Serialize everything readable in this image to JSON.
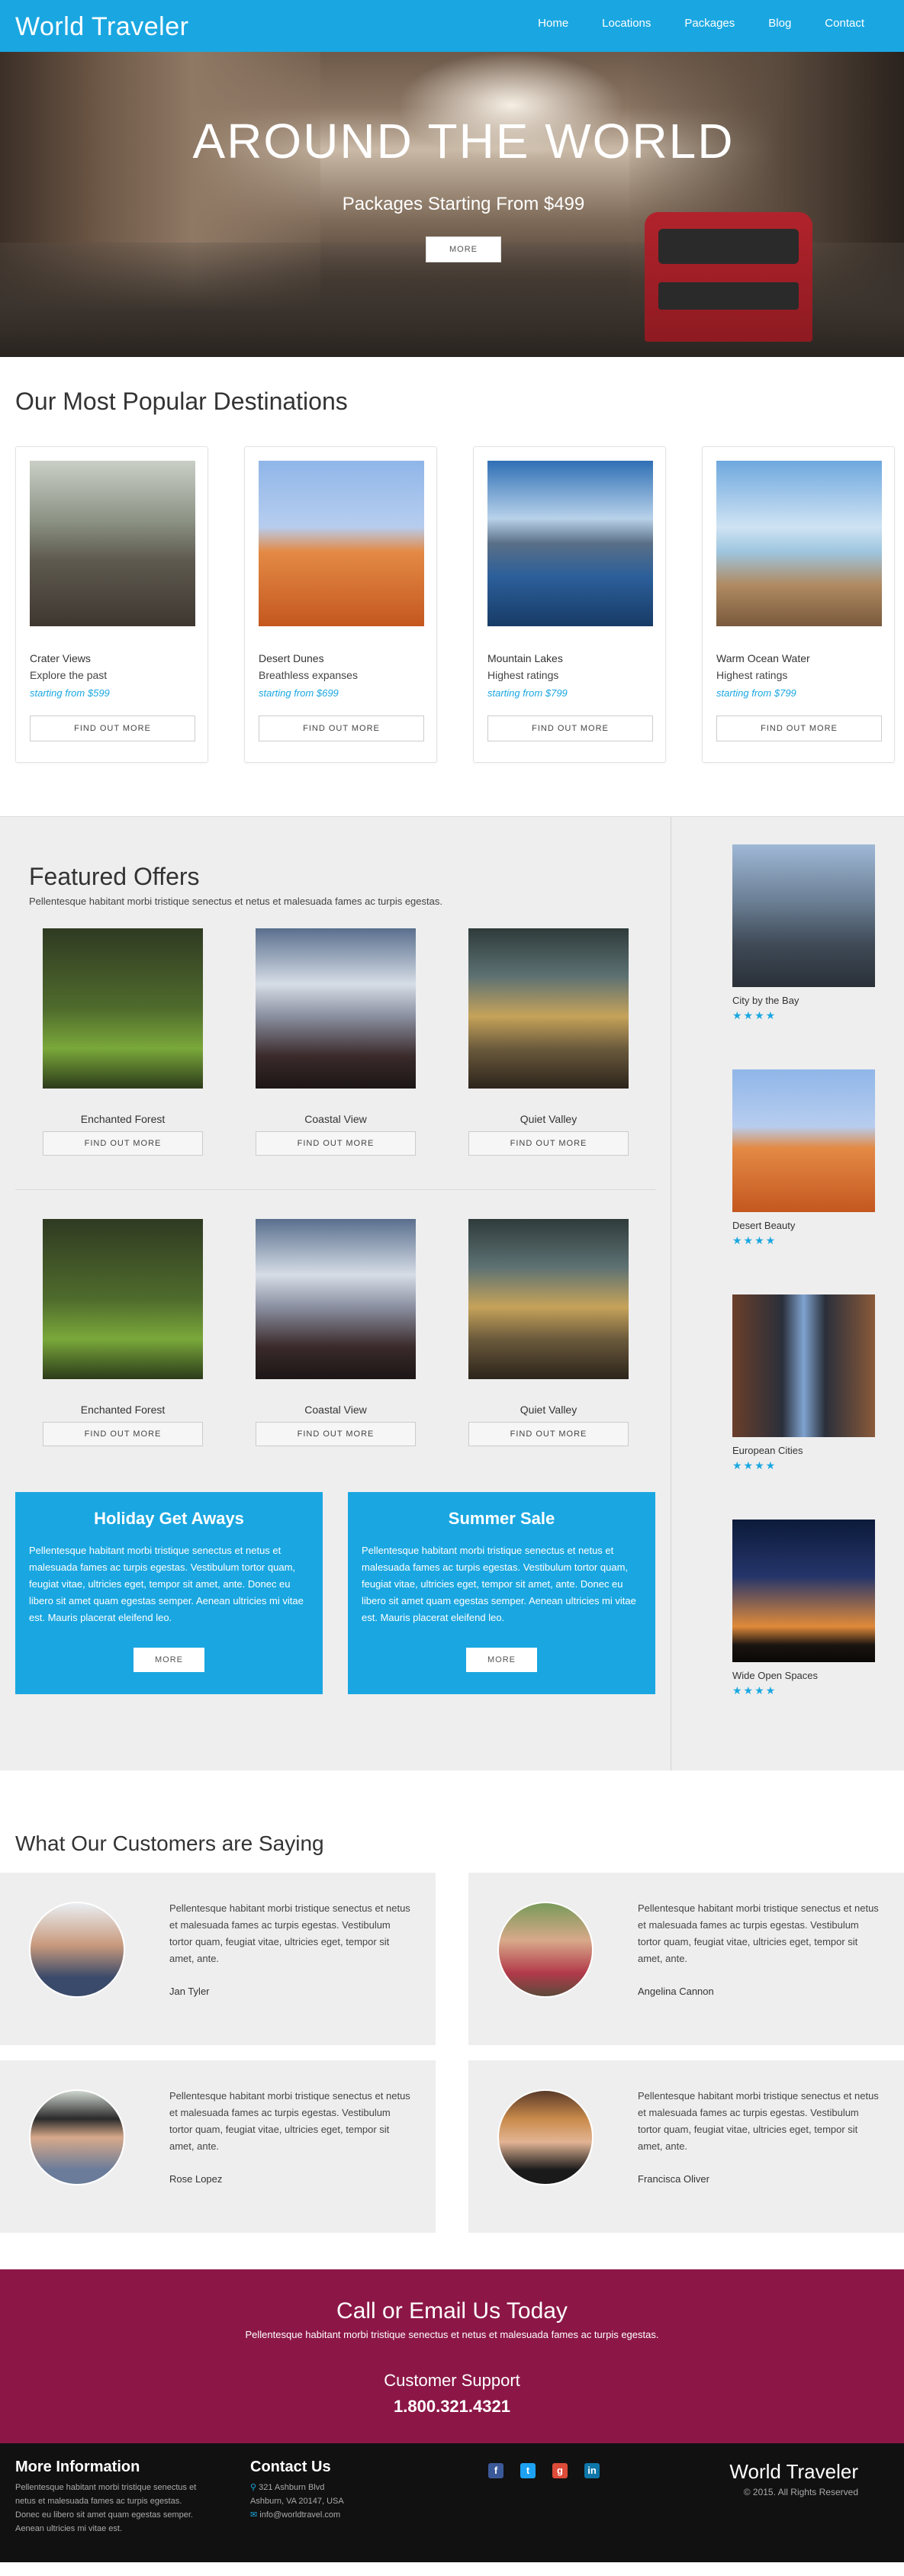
{
  "nav": {
    "brand": "World Traveler",
    "links": [
      "Home",
      "Locations",
      "Packages",
      "Blog",
      "Contact"
    ]
  },
  "hero": {
    "title": "AROUND THE WORLD",
    "subtitle": "Packages Starting From $499",
    "button": "MORE"
  },
  "destinations": {
    "heading": "Our Most Popular Destinations",
    "cards": [
      {
        "title": "Crater Views",
        "sub": "Explore the past",
        "price": "starting from $599",
        "button": "FIND OUT MORE"
      },
      {
        "title": "Desert Dunes",
        "sub": "Breathless expanses",
        "price": "starting from $699",
        "button": "FIND OUT MORE"
      },
      {
        "title": "Mountain Lakes",
        "sub": "Highest ratings",
        "price": "starting from $799",
        "button": "FIND OUT MORE"
      },
      {
        "title": "Warm Ocean Water",
        "sub": "Highest ratings",
        "price": "starting from $799",
        "button": "FIND OUT MORE"
      }
    ]
  },
  "featured": {
    "heading": "Featured Offers",
    "desc": "Pellentesque habitant morbi tristique senectus et netus et malesuada fames ac turpis egestas.",
    "row1": [
      {
        "name": "Enchanted Forest",
        "button": "FIND OUT MORE"
      },
      {
        "name": "Coastal View",
        "button": "FIND OUT MORE"
      },
      {
        "name": "Quiet Valley",
        "button": "FIND OUT MORE"
      }
    ],
    "row2": [
      {
        "name": "Enchanted Forest",
        "button": "FIND OUT MORE"
      },
      {
        "name": "Coastal View",
        "button": "FIND OUT MORE"
      },
      {
        "name": "Quiet Valley",
        "button": "FIND OUT MORE"
      }
    ],
    "promos": [
      {
        "title": "Holiday Get Aways",
        "text": "Pellentesque habitant morbi tristique senectus et netus et malesuada fames ac turpis egestas. Vestibulum tortor quam, feugiat vitae, ultricies eget, tempor sit amet, ante. Donec eu libero sit amet quam egestas semper. Aenean ultricies mi vitae est. Mauris placerat eleifend leo.",
        "button": "MORE"
      },
      {
        "title": "Summer Sale",
        "text": "Pellentesque habitant morbi tristique senectus et netus et malesuada fames ac turpis egestas. Vestibulum tortor quam, feugiat vitae, ultricies eget, tempor sit amet, ante. Donec eu libero sit amet quam egestas semper. Aenean ultricies mi vitae est. Mauris placerat eleifend leo.",
        "button": "MORE"
      }
    ],
    "sidebar": [
      {
        "name": "City by the Bay",
        "stars": "★★★★"
      },
      {
        "name": "Desert Beauty",
        "stars": "★★★★"
      },
      {
        "name": "European Cities",
        "stars": "★★★★"
      },
      {
        "name": "Wide Open Spaces",
        "stars": "★★★★"
      }
    ]
  },
  "testimonials": {
    "heading": "What Our Customers are Saying",
    "items": [
      {
        "quote": "Pellentesque habitant morbi tristique senectus et netus et malesuada fames ac turpis egestas. Vestibulum tortor quam, feugiat vitae, ultricies eget, tempor sit amet, ante.",
        "name": "Jan Tyler"
      },
      {
        "quote": "Pellentesque habitant morbi tristique senectus et netus et malesuada fames ac turpis egestas. Vestibulum tortor quam, feugiat vitae, ultricies eget, tempor sit amet, ante.",
        "name": "Angelina Cannon"
      },
      {
        "quote": "Pellentesque habitant morbi tristique senectus et netus et malesuada fames ac turpis egestas. Vestibulum tortor quam, feugiat vitae, ultricies eget, tempor sit amet, ante.",
        "name": "Rose Lopez"
      },
      {
        "quote": "Pellentesque habitant morbi tristique senectus et netus et malesuada fames ac turpis egestas. Vestibulum tortor quam, feugiat vitae, ultricies eget, tempor sit amet, ante.",
        "name": "Francisca Oliver"
      }
    ]
  },
  "band": {
    "heading": "Call or Email Us Today",
    "text": "Pellentesque habitant morbi tristique senectus et netus et malesuada fames ac turpis egestas.",
    "label": "Customer Support",
    "phone": "1.800.321.4321"
  },
  "footer": {
    "info_heading": "More Information",
    "info_text": "Pellentesque habitant morbi tristique senectus et netus et malesuada fames ac turpis egestas. Donec eu libero sit amet quam egestas semper. Aenean ultricies mi vitae est.",
    "contact_heading": "Contact Us",
    "address1": "321 Ashburn Blvd",
    "address2": "Ashburn, VA 20147, USA",
    "email": "info@worldtravel.com",
    "brand": "World Traveler",
    "copyright": "© 2015. All Rights Reserved"
  },
  "colors": {
    "accent": "#1aa7e1",
    "band": "#8c1747",
    "footer": "#111111",
    "section_bg": "#eeeeee"
  }
}
